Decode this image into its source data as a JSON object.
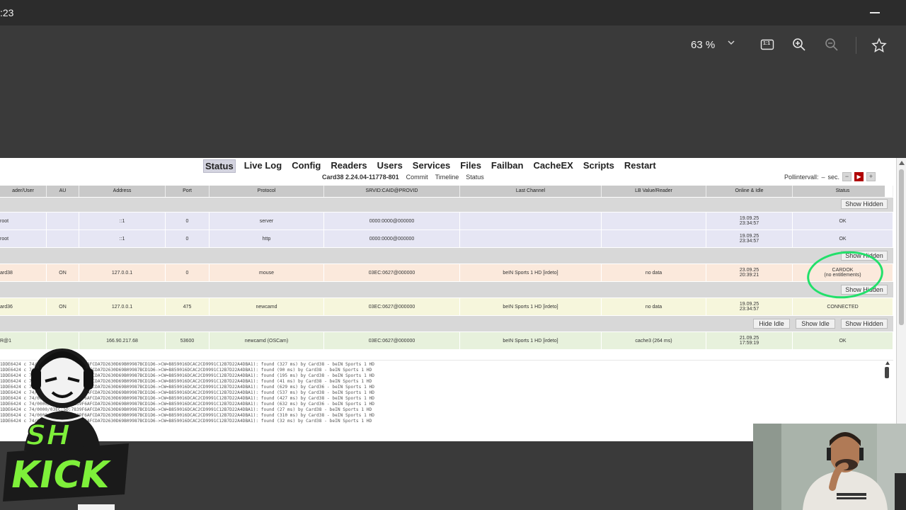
{
  "window": {
    "time": ":23"
  },
  "viewer": {
    "zoom": "63 %",
    "icons": [
      "chevron-down-icon",
      "actual-size-icon",
      "zoom-in-icon",
      "zoom-out-icon",
      "star-icon"
    ],
    "actual_size_label": "1:1"
  },
  "webif": {
    "menu": [
      "Status",
      "Live Log",
      "Config",
      "Readers",
      "Users",
      "Services",
      "Files",
      "Failban",
      "CacheEX",
      "Scripts",
      "Restart"
    ],
    "version": "Card38 2.24.04-11778-801",
    "sublinks": [
      "Commit",
      "Timeline",
      "Status"
    ],
    "poll_label": "Pollintervall:",
    "poll_unit": "sec.",
    "columns": [
      "ader/User",
      "AU",
      "Address",
      "Port",
      "Protocol",
      "SRVID:CAID@PROVID",
      "Last Channel",
      "LB Value/Reader",
      "Online & Idle",
      "Status"
    ],
    "buttons": {
      "show_hidden": "Show Hidden",
      "hide_idle": "Hide Idle",
      "show_idle": "Show Idle"
    },
    "rows": [
      {
        "user": "root",
        "au": "",
        "address": "::1",
        "port": "0",
        "protocol": "server",
        "srvid": "0000:0000@000000",
        "channel": "",
        "lb": "",
        "online": "19.09.25",
        "idle": "23:34:57",
        "status": "OK",
        "status2": ""
      },
      {
        "user": "root",
        "au": "",
        "address": "::1",
        "port": "0",
        "protocol": "http",
        "srvid": "0000:0000@000000",
        "channel": "",
        "lb": "",
        "online": "19.09.25",
        "idle": "23:34:57",
        "status": "OK",
        "status2": ""
      },
      {
        "user": "ard38",
        "au": "ON",
        "address": "127.0.0.1",
        "port": "0",
        "protocol": "mouse",
        "srvid": "03EC:0627@000000",
        "channel": "beIN Sports 1 HD [irdeto]",
        "lb": "no data",
        "online": "23.09.25",
        "idle": "20:39:21",
        "status": "CARDOK",
        "status2": "(no entitlements)"
      },
      {
        "user": "ard36",
        "au": "ON",
        "address": "127.0.0.1",
        "port": "475",
        "protocol": "newcamd",
        "srvid": "03EC:0627@000000",
        "channel": "beIN Sports 1 HD [irdeto]",
        "lb": "no data",
        "online": "19.09.25",
        "idle": "23:34:57",
        "status": "CONNECTED",
        "status2": ""
      },
      {
        "user": "R@1",
        "au": "",
        "address": "166.90.217.68",
        "port": "53600",
        "protocol": "newcamd (OSCam)",
        "srvid": "03EC:0627@000000",
        "channel": "beIN Sports 1 HD [irdeto]",
        "lb": "cache3 (264 ms)",
        "online": "21.09.25",
        "idle": "17:59:19",
        "status": "OK",
        "status2": ""
      }
    ],
    "log_lines": [
      "1DDE6424 c  74/0000/03EC:5D:7839F6AFCDA7D2630D69B09987BCD1D6->CW=B859016DCAC2CD9991C12B7D22A4DBA1): found (327 ms) by Card38 - beIN Sports 1 HD",
      "1DDE6424 c  74/0000/03EC:5D:7839F6AFCDA7D2630D69B09987BCD1D6->CW=B859016DCAC2CD9991C12B7D22A4DBA1): found (90 ms) by Card38 - beIN Sports 1 HD",
      "1DDE6424 c  74/0000/03EC:5D:7839F6AFCDA7D2630D69B09987BCD1D6->CW=B859016DCAC2CD9991C12B7D22A4DBA1): found (195 ms) by Card38 - beIN Sports 1 HD",
      "1DDE6424 c  74/0000/03EC:5D:7839F6AFCDA7D2630D69B09987BCD1D6->CW=B859016DCAC2CD9991C12B7D22A4DBA1): found (41 ms) by Card38 - beIN Sports 1 HD",
      "1DDE6424 c  74/0000/03EC:5D:7839F6AFCDA7D2630D69B09987BCD1D6->CW=B859016DCAC2CD9991C12B7D22A4DBA1): found (629 ms) by Card36 - beIN Sports 1 HD",
      "1DDE6424 c  74/0000/03EC:5D:7839F6AFCDA7D2630D69B09987BCD1D6->CW=B859016DCAC2CD9991C12B7D22A4DBA1): found (537 ms) by Card38 - beIN Sports 1 HD",
      "1DDE6424 c  74/0000/03EC:5D:7839F6AFCDA7D2630D69B09987BCD1D6->CW=B859016DCAC2CD9991C12B7D22A4DBA1): found (427 ms) by Card38 - beIN Sports 1 HD",
      "1DDE6424 c  74/0000/03EC:5D:7839F6AFCDA7D2630D69B09987BCD1D6->CW=B859016DCAC2CD9991C12B7D22A4DBA1): found (632 ms) by Card36 - beIN Sports 1 HD",
      "1DDE6424 c  74/0000/03EC:5D:7839F6AFCDA7D2630D69B09987BCD1D6->CW=B859016DCAC2CD9991C12B7D22A4DBA1): found (27 ms) by Card38 - beIN Sports 1 HD",
      "1DDE6424 c  74/0000/03EC:5D:7839F6AFCDA7D2630D69B09987BCD1D6->CW=B859016DCAC2CD9991C12B7D22A4DBA1): found (310 ms) by Card38 - beIN Sports 1 HD",
      "1DDE6424 c  74/0000/03EC:5D:7839F6AFCDA7D2630D69B09987BCD1D6->CW=B859016DCAC2CD9991C12B7D22A4DBA1): found (32 ms) by Card38 - beIN Sports 1 HD"
    ]
  },
  "overlay": {
    "logo_text_top": "SH",
    "logo_text_bottom": "KICK"
  },
  "colors": {
    "highlight_circle": "#22e06a",
    "logo_green": "#7ef03a"
  }
}
